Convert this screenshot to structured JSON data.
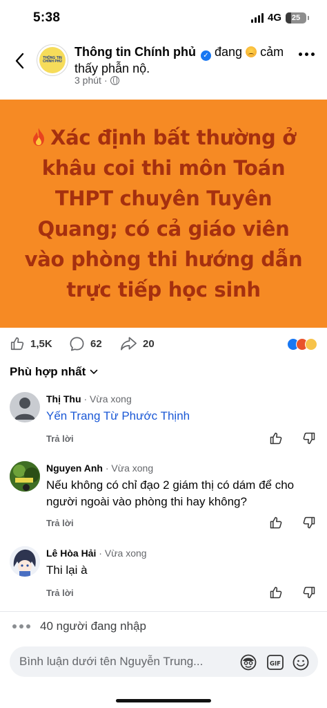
{
  "status_bar": {
    "time": "5:38",
    "network": "4G",
    "battery": "25",
    "battery_level": 0.25
  },
  "header": {
    "page_name": "Thông tin Chính phủ",
    "activity_prefix": "đang",
    "activity_suffix": "cảm thấy phẫn nộ.",
    "time": "3 phút",
    "separator": "·",
    "avatar_line1": "THÔNG TIN",
    "avatar_line2": "CHÍNH PHỦ"
  },
  "banner": {
    "headline": "Xác định bất thường ở khâu coi thi môn Toán THPT chuyên Tuyên Quang; có cả giáo viên vào phòng thi hướng dẫn trực tiếp học sinh",
    "background": "#f68a24",
    "text_color": "#a5300f"
  },
  "reactions": {
    "likes": "1,5K",
    "comments": "62",
    "shares": "20"
  },
  "sort": {
    "label": "Phù hợp nhất"
  },
  "comments": [
    {
      "name": "Thị Thu",
      "time": "Vừa xong",
      "text": "Yến Trang Từ Phước Thịnh",
      "reply": "Trả lời"
    },
    {
      "name": "Nguyen Anh",
      "time": "Vừa xong",
      "text": "Nếu không có chỉ đạo 2 giám thị có dám để cho người ngoài vào phòng thi hay không?",
      "reply": "Trả lời"
    },
    {
      "name": "Lê Hòa Hải",
      "time": "Vừa xong",
      "text": "Thi lại à",
      "reply": "Trả lời"
    }
  ],
  "typing": {
    "text": "40 người đang nhập"
  },
  "composer": {
    "placeholder": "Bình luận dưới tên Nguyễn Trung..."
  },
  "colors": {
    "brand_blue": "#1877f2",
    "link_blue": "#1a58d6",
    "muted": "#65676b"
  }
}
